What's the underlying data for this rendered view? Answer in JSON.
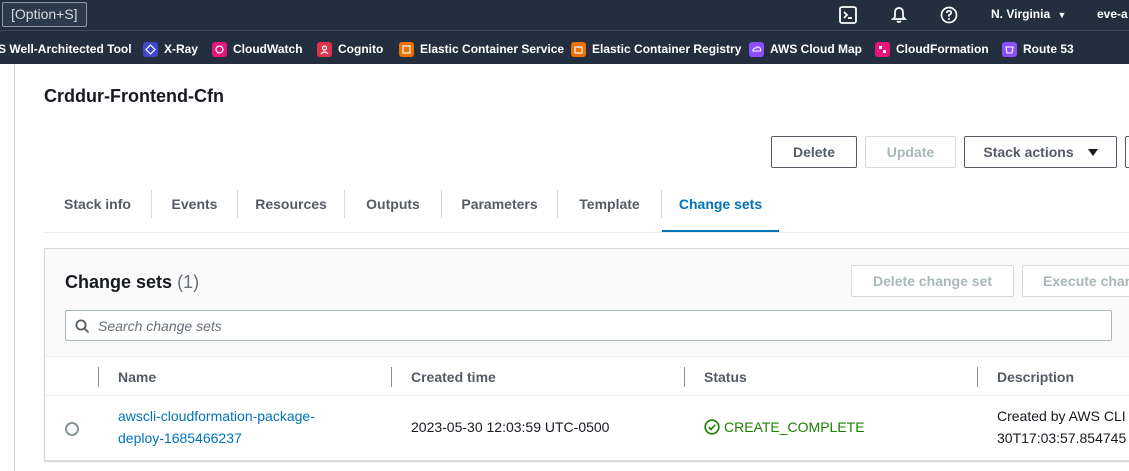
{
  "topnav": {
    "shortcut_label": "[Option+S]",
    "icons": [
      "cloudshell-icon",
      "notifications-icon",
      "help-icon"
    ],
    "region": "N. Virginia",
    "account": "eve-a"
  },
  "favorites": [
    {
      "label": "S Well-Architected Tool",
      "color": "#232f3e"
    },
    {
      "label": "X-Ray",
      "color": "#3f48cc"
    },
    {
      "label": "CloudWatch",
      "color": "#e7157b"
    },
    {
      "label": "Cognito",
      "color": "#dd344c"
    },
    {
      "label": "Elastic Container Service",
      "color": "#ed7100"
    },
    {
      "label": "Elastic Container Registry",
      "color": "#ed7100"
    },
    {
      "label": "AWS Cloud Map",
      "color": "#8c4fff"
    },
    {
      "label": "CloudFormation",
      "color": "#e7157b"
    },
    {
      "label": "Route 53",
      "color": "#8c4fff"
    }
  ],
  "stack": {
    "title": "Crddur-Frontend-Cfn",
    "actions": {
      "delete": "Delete",
      "update": "Update",
      "stack_actions": "Stack actions"
    }
  },
  "tabs": [
    "Stack info",
    "Events",
    "Resources",
    "Outputs",
    "Parameters",
    "Template",
    "Change sets"
  ],
  "active_tab": "Change sets",
  "change_sets": {
    "title": "Change sets",
    "count": "(1)",
    "delete_button": "Delete change set",
    "execute_button": "Execute chan",
    "search_placeholder": "Search change sets",
    "columns": [
      "Name",
      "Created time",
      "Status",
      "Description"
    ],
    "rows": [
      {
        "name_line1": "awscli-cloudformation-package-",
        "name_line2": "deploy-1685466237",
        "created": "2023-05-30 12:03:59 UTC-0500",
        "status": "CREATE_COMPLETE",
        "desc_line1": "Created by AWS CLI a",
        "desc_line2": "30T17:03:57.854745"
      }
    ]
  },
  "colors": {
    "nav_bg": "#232f3e",
    "link": "#0073bb",
    "success": "#1d8102"
  }
}
